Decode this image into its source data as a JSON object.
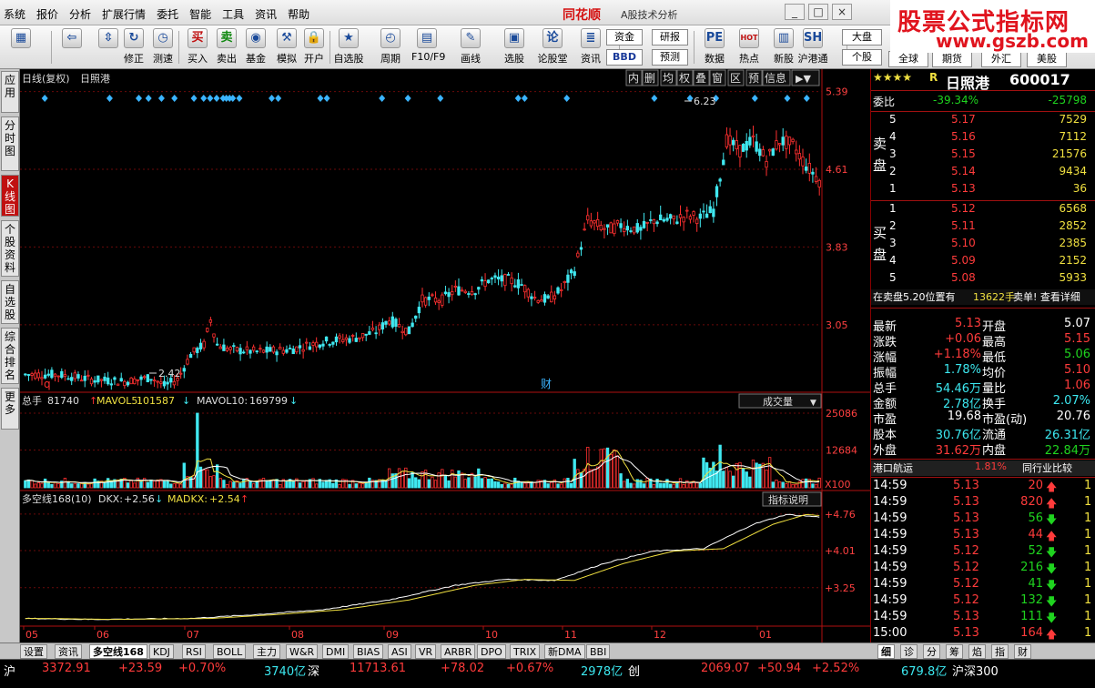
{
  "menubar": {
    "items": [
      "系统",
      "报价",
      "分析",
      "扩展行情",
      "委托",
      "智能",
      "工具",
      "资讯",
      "帮助"
    ],
    "brand": "同花顺",
    "app_title": "A股技术分析"
  },
  "watermark": {
    "line1": "股票公式指标网",
    "line2": "www.gszb.com"
  },
  "toolbar": {
    "buttons": [
      {
        "label": "",
        "icon": "multi-window-icon",
        "glyph": "▦"
      },
      {
        "label": "",
        "icon": "back-arrow-icon",
        "glyph": "⇦"
      },
      {
        "label": "",
        "icon": "up-down-arrow-icon",
        "glyph": "⇳"
      },
      {
        "label": "修正",
        "icon": "fix-icon",
        "glyph": "↻"
      },
      {
        "label": "测速",
        "icon": "speed-test-icon",
        "glyph": "◷"
      },
      {
        "label": "买入",
        "icon": "buy-icon",
        "glyph": "买"
      },
      {
        "label": "卖出",
        "icon": "sell-icon",
        "glyph": "卖"
      },
      {
        "label": "基金",
        "icon": "fund-icon",
        "glyph": "◉"
      },
      {
        "label": "模拟",
        "icon": "simulate-icon",
        "glyph": "⚒"
      },
      {
        "label": "开户",
        "icon": "lock-icon",
        "glyph": "🔒"
      },
      {
        "label": "自选股",
        "icon": "star-icon",
        "glyph": "★"
      },
      {
        "label": "周期",
        "icon": "clock-icon",
        "glyph": "◴"
      },
      {
        "label": "F10/F9",
        "icon": "f10-icon",
        "glyph": "▤"
      },
      {
        "label": "画线",
        "icon": "pencil-icon",
        "glyph": "✎"
      },
      {
        "label": "选股",
        "icon": "select-stock-icon",
        "glyph": "▣"
      },
      {
        "label": "论股堂",
        "icon": "forum-icon",
        "glyph": "论"
      },
      {
        "label": "资讯",
        "icon": "info-icon",
        "glyph": "≣"
      },
      {
        "label": "数据",
        "icon": "data-icon",
        "glyph": "PE"
      },
      {
        "label": "热点",
        "icon": "hot-icon",
        "glyph": "HOT"
      },
      {
        "label": "新股",
        "icon": "new-stock-icon",
        "glyph": "▥"
      },
      {
        "label": "沪港通",
        "icon": "hk-icon",
        "glyph": "SH"
      }
    ],
    "small_buttons": [
      "资金",
      "研报",
      "BBD",
      "预测"
    ],
    "right_buttons": [
      "大盘",
      "个股",
      "全球",
      "期货",
      "外汇",
      "美股"
    ]
  },
  "left_tabs": [
    "应用",
    "分时图",
    "K线图",
    "个股资料",
    "自选股",
    "综合排名",
    "更多"
  ],
  "chart": {
    "header_left": "日线(复权)",
    "stock_name": "日照港",
    "tool_buttons": [
      "内",
      "删",
      "均",
      "权",
      "叠",
      "窗",
      "区",
      "预",
      "信息"
    ],
    "price_axis": [
      "5.39",
      "4.61",
      "3.83",
      "3.05"
    ],
    "high_label": "6.23",
    "low_label": "2.42",
    "marker_q": "q",
    "marker_cai": "财",
    "volume_header": {
      "name": "总手",
      "value": "81740",
      "mavol5_label": "MAVOL5:",
      "mavol5": "101587",
      "mavol10_label": "MAVOL10:",
      "mavol10": "169799"
    },
    "volume_selector": "成交量",
    "volume_axis": [
      "25086",
      "12684"
    ],
    "volume_unit": "X100",
    "indicator_header": {
      "name": "多空线168(10)",
      "dkx_label": "DKX:",
      "dkx": "+2.56",
      "madkx_label": "MADKX:",
      "madkx": "+2.54"
    },
    "indicator_button": "指标说明",
    "indicator_axis": [
      "+4.76",
      "+4.01",
      "+3.25"
    ],
    "month_labels": [
      "05",
      "06",
      "07",
      "08",
      "09",
      "10",
      "11",
      "12",
      "01"
    ]
  },
  "chart_data": {
    "type": "candlestick",
    "title": "日照港",
    "ylim": [
      2.4,
      5.45
    ],
    "months": [
      "05",
      "06",
      "07",
      "08",
      "09",
      "10",
      "11",
      "12",
      "01"
    ],
    "close_trend": [
      [
        0,
        2.55
      ],
      [
        10,
        2.55
      ],
      [
        20,
        2.5
      ],
      [
        30,
        2.48
      ],
      [
        38,
        2.52
      ],
      [
        42,
        2.44
      ],
      [
        46,
        2.5
      ],
      [
        50,
        2.75
      ],
      [
        54,
        2.85
      ],
      [
        56,
        3.1
      ],
      [
        58,
        2.85
      ],
      [
        62,
        2.8
      ],
      [
        70,
        2.78
      ],
      [
        80,
        2.8
      ],
      [
        90,
        2.88
      ],
      [
        100,
        2.92
      ],
      [
        106,
        2.98
      ],
      [
        110,
        3.1
      ],
      [
        116,
        2.98
      ],
      [
        120,
        3.3
      ],
      [
        126,
        3.3
      ],
      [
        130,
        3.4
      ],
      [
        136,
        3.4
      ],
      [
        140,
        3.5
      ],
      [
        146,
        3.5
      ],
      [
        150,
        3.45
      ],
      [
        154,
        3.32
      ],
      [
        158,
        3.3
      ],
      [
        162,
        3.4
      ],
      [
        166,
        3.6
      ],
      [
        170,
        4.1
      ],
      [
        176,
        4.0
      ],
      [
        180,
        4.05
      ],
      [
        186,
        4.0
      ],
      [
        190,
        4.1
      ],
      [
        196,
        4.1
      ],
      [
        200,
        4.15
      ],
      [
        204,
        4.12
      ],
      [
        208,
        4.2
      ],
      [
        212,
        4.9
      ],
      [
        216,
        4.8
      ],
      [
        220,
        4.9
      ],
      [
        224,
        4.7
      ],
      [
        228,
        4.9
      ],
      [
        232,
        4.85
      ],
      [
        236,
        4.65
      ],
      [
        240,
        4.5
      ]
    ],
    "volume_ma": "MAVOL5 / MAVOL10",
    "dkx_trend": [
      [
        0,
        2.62
      ],
      [
        20,
        2.6
      ],
      [
        50,
        2.62
      ],
      [
        70,
        2.7
      ],
      [
        90,
        2.8
      ],
      [
        110,
        3.0
      ],
      [
        130,
        3.3
      ],
      [
        145,
        3.42
      ],
      [
        160,
        3.4
      ],
      [
        175,
        3.75
      ],
      [
        190,
        4.0
      ],
      [
        205,
        4.05
      ],
      [
        220,
        4.55
      ],
      [
        230,
        4.75
      ],
      [
        240,
        4.7
      ]
    ]
  },
  "right_panel": {
    "header": {
      "stars": "★★★★",
      "r": "R",
      "name": "日照港",
      "code": "600017"
    },
    "weibi": {
      "label": "委比",
      "pct": "-39.34%",
      "val": "-25798"
    },
    "sell_label": "卖盘",
    "buy_label": "买盘",
    "asks": [
      {
        "lvl": "5",
        "price": "5.17",
        "vol": "7529"
      },
      {
        "lvl": "4",
        "price": "5.16",
        "vol": "7112"
      },
      {
        "lvl": "3",
        "price": "5.15",
        "vol": "21576"
      },
      {
        "lvl": "2",
        "price": "5.14",
        "vol": "9434"
      },
      {
        "lvl": "1",
        "price": "5.13",
        "vol": "36"
      }
    ],
    "bids": [
      {
        "lvl": "1",
        "price": "5.12",
        "vol": "6568"
      },
      {
        "lvl": "2",
        "price": "5.11",
        "vol": "2852"
      },
      {
        "lvl": "3",
        "price": "5.10",
        "vol": "2385"
      },
      {
        "lvl": "4",
        "price": "5.09",
        "vol": "2152"
      },
      {
        "lvl": "5",
        "price": "5.08",
        "vol": "5933"
      }
    ],
    "notice": {
      "pre": "在卖盘5.20位置有",
      "num": "13622手",
      "post": "卖单! 查看详细"
    },
    "quote": [
      {
        "l1": "最新",
        "v1": "5.13",
        "c1": "red",
        "l2": "开盘",
        "v2": "5.07",
        "c2": "white"
      },
      {
        "l1": "涨跌",
        "v1": "+0.06",
        "c1": "red",
        "l2": "最高",
        "v2": "5.15",
        "c2": "red"
      },
      {
        "l1": "涨幅",
        "v1": "+1.18%",
        "c1": "red",
        "l2": "最低",
        "v2": "5.06",
        "c2": "green"
      },
      {
        "l1": "振幅",
        "v1": "1.78%",
        "c1": "cyan",
        "l2": "均价",
        "v2": "5.10",
        "c2": "red"
      },
      {
        "l1": "总手",
        "v1": "54.46万",
        "c1": "cyan",
        "l2": "量比",
        "v2": "1.06",
        "c2": "red"
      },
      {
        "l1": "金额",
        "v1": "2.78亿",
        "c1": "cyan",
        "l2": "换手",
        "v2": "2.07%",
        "c2": "cyan"
      },
      {
        "l1": "市盈",
        "v1": "19.68",
        "c1": "white",
        "l2": "市盈(动)",
        "v2": "20.76",
        "c2": "white"
      },
      {
        "l1": "股本",
        "v1": "30.76亿",
        "c1": "cyan",
        "l2": "流通",
        "v2": "26.31亿",
        "c2": "cyan"
      },
      {
        "l1": "外盘",
        "v1": "31.62万",
        "c1": "red",
        "l2": "内盘",
        "v2": "22.84万",
        "c2": "green"
      }
    ],
    "industry": {
      "name": "港口航运",
      "pct": "1.81%",
      "compare": "同行业比较"
    },
    "ticks": [
      {
        "t": "14:59",
        "p": "5.13",
        "v": "20",
        "d": "up"
      },
      {
        "t": "14:59",
        "p": "5.13",
        "v": "820",
        "d": "up"
      },
      {
        "t": "14:59",
        "p": "5.13",
        "v": "56",
        "d": "down"
      },
      {
        "t": "14:59",
        "p": "5.13",
        "v": "44",
        "d": "up"
      },
      {
        "t": "14:59",
        "p": "5.12",
        "v": "52",
        "d": "down"
      },
      {
        "t": "14:59",
        "p": "5.12",
        "v": "216",
        "d": "down"
      },
      {
        "t": "14:59",
        "p": "5.12",
        "v": "41",
        "d": "down"
      },
      {
        "t": "14:59",
        "p": "5.12",
        "v": "132",
        "d": "down"
      },
      {
        "t": "14:59",
        "p": "5.13",
        "v": "111",
        "d": "down"
      },
      {
        "t": "15:00",
        "p": "5.13",
        "v": "164",
        "d": "up"
      }
    ],
    "tick_extra": [
      "1",
      "1",
      "1",
      "1",
      "1",
      "1",
      "1",
      "1",
      "1",
      "1"
    ],
    "tabs": [
      "细",
      "诊",
      "分",
      "筹",
      "焰",
      "指",
      "财"
    ]
  },
  "bottom_tabs": [
    "设置",
    "资讯",
    "多空线168",
    "KDJ",
    "RSI",
    "BOLL",
    "主力",
    "W&R",
    "DMI",
    "BIAS",
    "ASI",
    "VR",
    "ARBR",
    "DPO",
    "TRIX",
    "新DMA",
    "BBI"
  ],
  "statusbar": {
    "sh_label": "沪",
    "sh_index": "3372.91",
    "sh_change": "+23.59",
    "sh_pct": "+0.70%",
    "sh_amount": "3740亿",
    "sz_label": "深",
    "sz_index": "11713.61",
    "sz_change": "+78.02",
    "sz_pct": "+0.67%",
    "sz_amount": "2978亿",
    "cy_label": "创",
    "cy_index": "2069.07",
    "cy_change": "+50.94",
    "cy_pct": "+2.52%",
    "hs_amount": "679.8亿",
    "hs_label": "沪深300"
  }
}
